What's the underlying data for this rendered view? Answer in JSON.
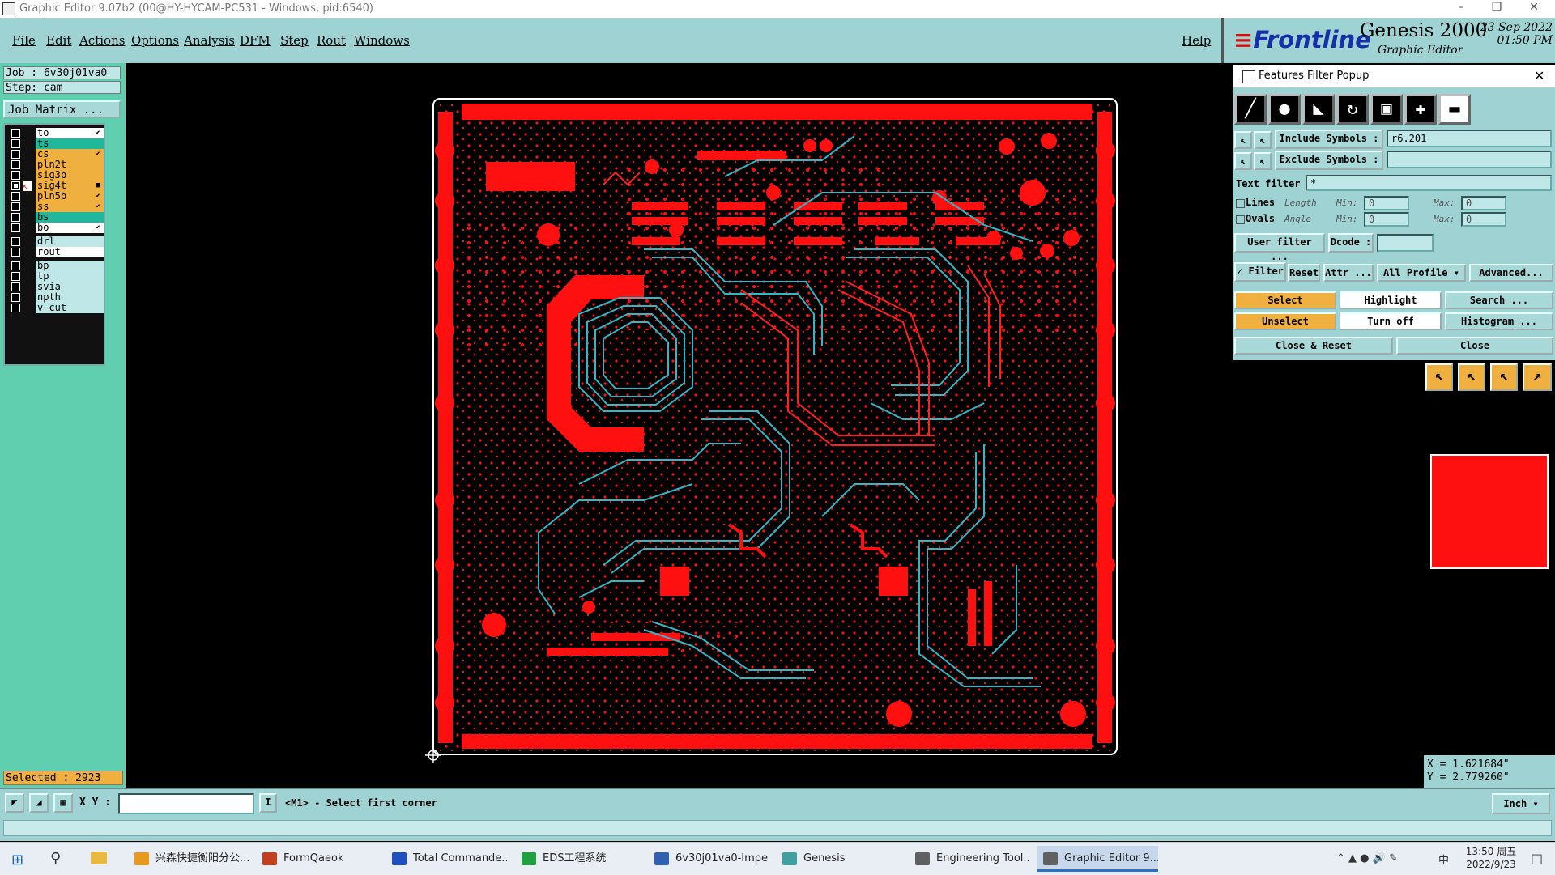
{
  "window": {
    "title": "Graphic Editor 9.07b2 (00@HY-HYCAM-PC531 - Windows, pid:6540)"
  },
  "menu": [
    "File",
    "Edit",
    "Actions",
    "Options",
    "Analysis",
    "DFM",
    "Step",
    "Rout",
    "Windows"
  ],
  "help_label": "Help",
  "logo": {
    "brand": "Frontline",
    "product": "Genesis 2000",
    "subtitle": "Graphic Editor",
    "date_line1": "23 Sep 2022",
    "date_line2": "01:50 PM"
  },
  "left": {
    "job": "Job : 6v30j01va0",
    "step": "Step: cam",
    "job_matrix": "Job Matrix ...",
    "selected": "Selected : 2923",
    "layers": [
      {
        "name": "to",
        "color": "#ffffff",
        "checked": false,
        "mark": "⬋"
      },
      {
        "name": "ts",
        "color": "#1fb89a",
        "checked": false,
        "mark": ""
      },
      {
        "name": "cs",
        "color": "#f0b040",
        "checked": false,
        "mark": "⬋"
      },
      {
        "name": "pln2t",
        "color": "#f0b040",
        "checked": false,
        "mark": ""
      },
      {
        "name": "sig3b",
        "color": "#f0b040",
        "checked": false,
        "mark": ""
      },
      {
        "name": "sig4t",
        "color": "#f0b040",
        "checked": true,
        "mark": "■"
      },
      {
        "name": "pln5b",
        "color": "#f0b040",
        "checked": false,
        "mark": "⬋"
      },
      {
        "name": "ss",
        "color": "#f0b040",
        "checked": false,
        "mark": "⬋"
      },
      {
        "name": "bs",
        "color": "#1fb89a",
        "checked": false,
        "mark": ""
      },
      {
        "name": "bo",
        "color": "#ffffff",
        "checked": false,
        "mark": "⬋"
      },
      {
        "name": "drl",
        "color": "#bfe7e7",
        "checked": false,
        "mark": ""
      },
      {
        "name": "rout",
        "color": "#ffffff",
        "checked": false,
        "mark": ""
      },
      {
        "name": "bp",
        "color": "#bfe7e7",
        "checked": false,
        "mark": ""
      },
      {
        "name": "tp",
        "color": "#bfe7e7",
        "checked": false,
        "mark": ""
      },
      {
        "name": "svia",
        "color": "#bfe7e7",
        "checked": false,
        "mark": ""
      },
      {
        "name": "npth",
        "color": "#bfe7e7",
        "checked": false,
        "mark": ""
      },
      {
        "name": "v-cut",
        "color": "#bfe7e7",
        "checked": false,
        "mark": ""
      }
    ]
  },
  "filter": {
    "title": "Features Filter Popup",
    "include_label": "Include Symbols :",
    "include_value": "r6.201",
    "exclude_label": "Exclude Symbols :",
    "exclude_value": "",
    "text_filter_label": "Text filter",
    "text_filter_value": "*",
    "lines_label": "Lines",
    "ovals_label": "Ovals",
    "length_label": "Length",
    "angle_label": "Angle",
    "min_label": "Min:",
    "max_label": "Max:",
    "zero": "0",
    "user_filter": "User filter ...",
    "dcode_label": "Dcode :",
    "filter_label": "Filter",
    "reset": "Reset",
    "attr": "Attr ...",
    "all_profile": "All Profile",
    "advanced": "Advanced...",
    "select": "Select",
    "highlight": "Highlight",
    "search": "Search ...",
    "unselect": "Unselect",
    "turn_off": "Turn off",
    "histogram": "Histogram ...",
    "close_reset": "Close & Reset",
    "close": "Close"
  },
  "coords": {
    "x": "X = 1.621684\"",
    "y": "Y = 2.779260\""
  },
  "command": {
    "xy_label": "X Y :",
    "prompt": "<M1> - Select first corner",
    "units": "Inch"
  },
  "taskbar": {
    "tasks": [
      "兴森快捷衡阳分公...",
      "FormQaeok",
      "Total Commande...",
      "EDS工程系统",
      "6v30j01va0-Impe...",
      "Genesis",
      "Engineering Tool...",
      "Graphic Editor 9...."
    ],
    "time": "13:50 周五",
    "date": "2022/9/23",
    "ime": "中"
  },
  "colors": {
    "panel": "#9fd3d3",
    "accent_orange": "#f0b040",
    "copper_red": "#ff1010",
    "trace_cyan": "#30b8c8"
  }
}
